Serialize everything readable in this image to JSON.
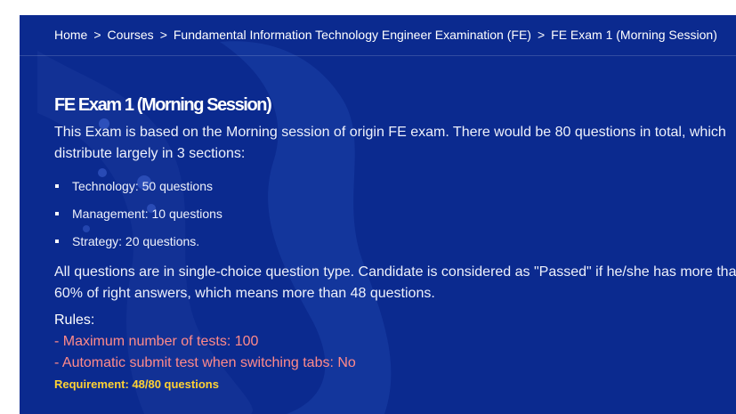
{
  "breadcrumb": {
    "items": [
      "Home",
      "Courses",
      "Fundamental Information Technology Engineer Examination (FE)",
      "FE Exam 1 (Morning Session)"
    ],
    "separator": ">"
  },
  "exam": {
    "title": "FE Exam 1 (Morning Session)",
    "intro_lines": [
      "This Exam is based on the Morning session of origin FE exam. There would be 80 questions in total, which",
      "distribute largely in 3 sections:"
    ],
    "sections": [
      "Technology: 50 questions",
      "Management: 10 questions",
      "Strategy: 20 questions."
    ],
    "pass_lines": [
      "All questions are in single-choice question type. Candidate is considered as \"Passed\" if he/she has more than",
      "60% of right answers, which means more than 48 questions."
    ],
    "rules_heading": "Rules:",
    "rules": [
      "- Maximum number of tests: 100",
      "- Automatic submit test when switching tabs: No"
    ],
    "requirement": "Requirement: 48/80 questions"
  },
  "colors": {
    "hero_bg": "#0b2a8f",
    "rule_text": "#ff8a8a",
    "requirement_text": "#ffd233"
  }
}
